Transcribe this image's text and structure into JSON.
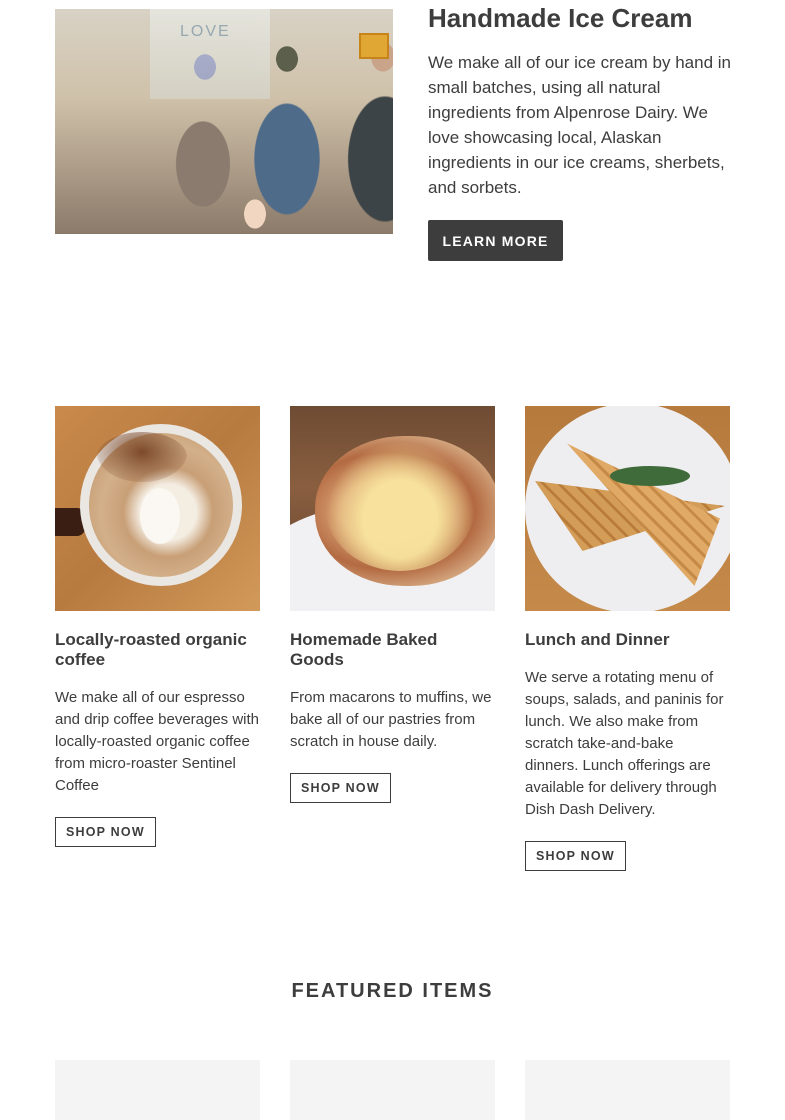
{
  "hero": {
    "title": "Handmade Ice Cream",
    "text": "We make all of our ice cream by hand in small batches, using all natural ingredients from Alpenrose Dairy. We love showcasing local, Alaskan ingredients in our ice creams, sherbets, and sorbets.",
    "button_label": "LEARN MORE",
    "window_sign": "LOVE"
  },
  "cards": [
    {
      "title": "Locally-roasted organic coffee",
      "text": "We make all of our espresso and drip coffee beverages with locally-roasted organic coffee from micro-roaster Sentinel Coffee",
      "button_label": "SHOP NOW"
    },
    {
      "title": "Homemade Baked Goods",
      "text": "From macarons to muffins, we bake all of our pastries from scratch in house daily.",
      "button_label": "SHOP NOW"
    },
    {
      "title": "Lunch and Dinner",
      "text": "We serve a rotating menu of soups, salads, and paninis for lunch. We also make from scratch take-and-bake dinners. Lunch offerings are available for delivery through Dish Dash Delivery.",
      "button_label": "SHOP NOW"
    }
  ],
  "featured": {
    "title": "FEATURED ITEMS"
  },
  "colors": {
    "text": "#3d3d3d",
    "button_dark": "#3d3d3d",
    "placeholder": "#f4f4f4"
  }
}
